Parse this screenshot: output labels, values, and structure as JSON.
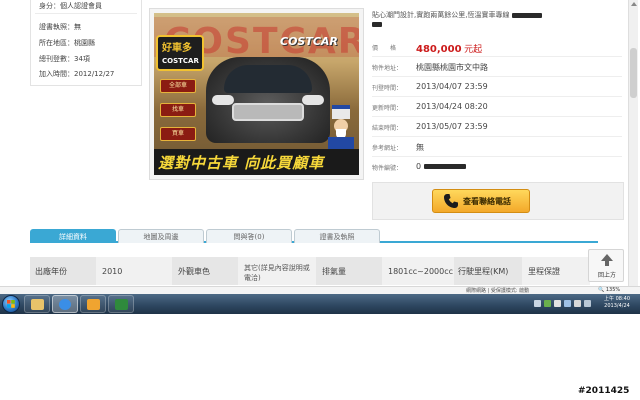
{
  "seller": {
    "identity": "身分：個人認證會員",
    "certificate": "證書執照：無",
    "region_label": "所在地區：",
    "region_value": "桃園縣",
    "listings": "總刊登數：34項",
    "joined": "加入時間：2012/12/27"
  },
  "photo": {
    "banner_text": "COSTCAR",
    "logo_top": "好車多",
    "logo_bottom": "COSTCAR",
    "buttons": [
      "全部車",
      "找車",
      "買車"
    ],
    "slogan": "選對中古車 向此買顧車"
  },
  "listing": {
    "title": "貼心潮門設計,實跑兩萬餘公里,恆溫實車專線"
  },
  "details": {
    "price_label": "價　　格",
    "price_value": "480,000",
    "price_unit": "元起",
    "location_label": "物件地址：",
    "location_value": "桃園縣桃園市文中路",
    "posted_label": "刊登時間：",
    "posted_value": "2013/04/07 23:59",
    "updated_label": "更新時間：",
    "updated_value": "2013/04/24 08:20",
    "ends_label": "結束時間：",
    "ends_value": "2013/05/07 23:59",
    "ref_label": "參考網址：",
    "ref_value": "無",
    "id_label": "物件編號：",
    "id_value": "0"
  },
  "call_button": "查看聯絡電話",
  "tabs": [
    "詳細資料",
    "地圖及周邊",
    "問與答(0)",
    "證書及執照"
  ],
  "specs": {
    "year_label": "出廠年份",
    "year_value": "2010",
    "color_label": "外觀車色",
    "color_value": "其它(詳見內容說明或電洽)",
    "displacement_label": "排氣量",
    "displacement_value": "1801cc~2000cc",
    "mileage_label": "行駛里程(KM)",
    "mileage_value": "里程保證"
  },
  "back_to_top": "回上方",
  "ie_status": {
    "zone": "網際網路 | 受保護模式: 啟動",
    "zoom": "135%"
  },
  "taskbar": {
    "apps": [
      "windows-explorer",
      "internet-explorer",
      "media-player",
      "excel"
    ],
    "time": "上午 08:40",
    "date": "2013/4/24"
  },
  "watermark": "#2011425",
  "colors": {
    "tab_accent": "#3aa8d4",
    "price_red": "#cc1b1b",
    "call_button": "#f3a92a"
  }
}
